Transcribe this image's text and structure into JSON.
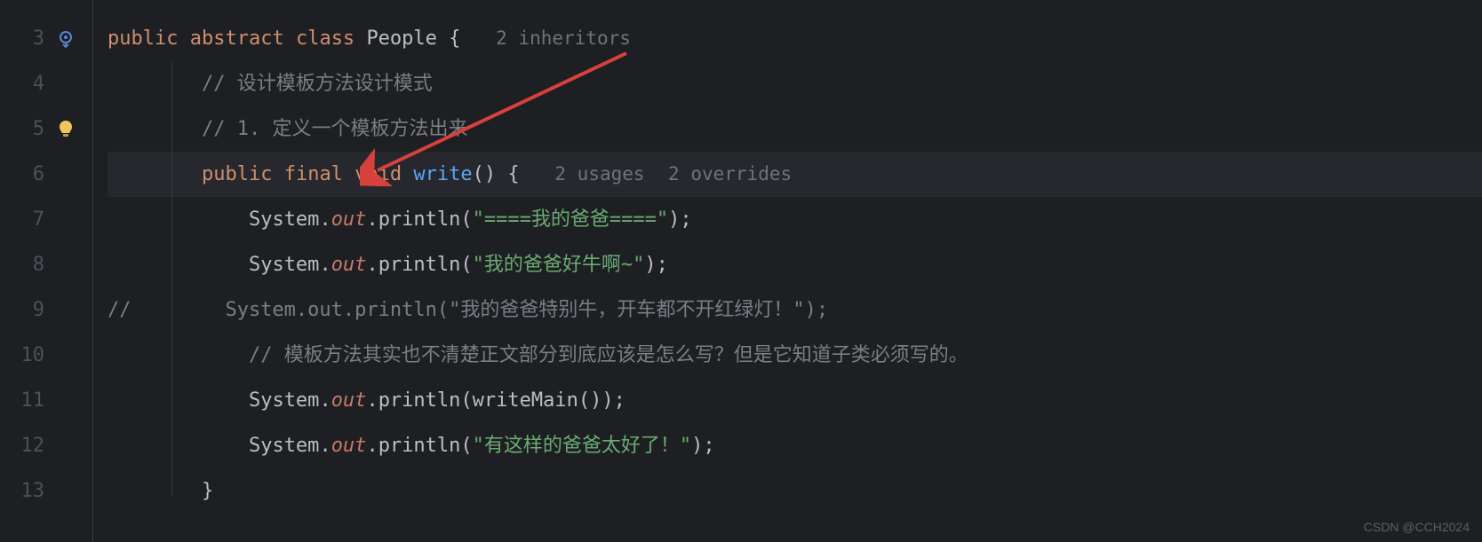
{
  "lines": [
    {
      "num": "3",
      "icon": "override"
    },
    {
      "num": "4",
      "icon": null
    },
    {
      "num": "5",
      "icon": "bulb"
    },
    {
      "num": "6",
      "icon": null,
      "highlighted": true
    },
    {
      "num": "7",
      "icon": null
    },
    {
      "num": "8",
      "icon": null
    },
    {
      "num": "9",
      "icon": null
    },
    {
      "num": "10",
      "icon": null
    },
    {
      "num": "11",
      "icon": null
    },
    {
      "num": "12",
      "icon": null
    },
    {
      "num": "13",
      "icon": null
    }
  ],
  "code": {
    "l3": {
      "kw1": "public",
      "kw2": "abstract",
      "kw3": "class",
      "cls": "People",
      "brace": " {",
      "hint": "2 inheritors"
    },
    "l4": {
      "cmt": "// 设计模板方法设计模式"
    },
    "l5": {
      "cmt": "// 1. 定义一个模板方法出来"
    },
    "l6": {
      "kw1": "public",
      "kw2": "final",
      "kw3": "void",
      "mth": "write",
      "paren": "() {",
      "hint1": "2 usages",
      "hint2": "2 overrides"
    },
    "l7": {
      "cls": "System",
      "dot1": ".",
      "fld": "out",
      "dot2": ".",
      "mth": "println",
      "open": "(",
      "str": "\"====我的爸爸====\"",
      "close": ");"
    },
    "l8": {
      "cls": "System",
      "dot1": ".",
      "fld": "out",
      "dot2": ".",
      "mth": "println",
      "open": "(",
      "str": "\"我的爸爸好牛啊~\"",
      "close": ");"
    },
    "l9": {
      "cmt": "//        System.out.println(\"我的爸爸特别牛，开车都不开红绿灯！\");"
    },
    "l10": {
      "cmt": "// 模板方法其实也不清楚正文部分到底应该是怎么写？但是它知道子类必须写的。"
    },
    "l11": {
      "cls": "System",
      "dot1": ".",
      "fld": "out",
      "dot2": ".",
      "mth": "println",
      "open": "(",
      "arg": "writeMain()",
      "close": ");"
    },
    "l12": {
      "cls": "System",
      "dot1": ".",
      "fld": "out",
      "dot2": ".",
      "mth": "println",
      "open": "(",
      "str": "\"有这样的爸爸太好了！\"",
      "close": ");"
    },
    "l13": {
      "brace": "}"
    }
  },
  "watermark": "CSDN @CCH2024"
}
